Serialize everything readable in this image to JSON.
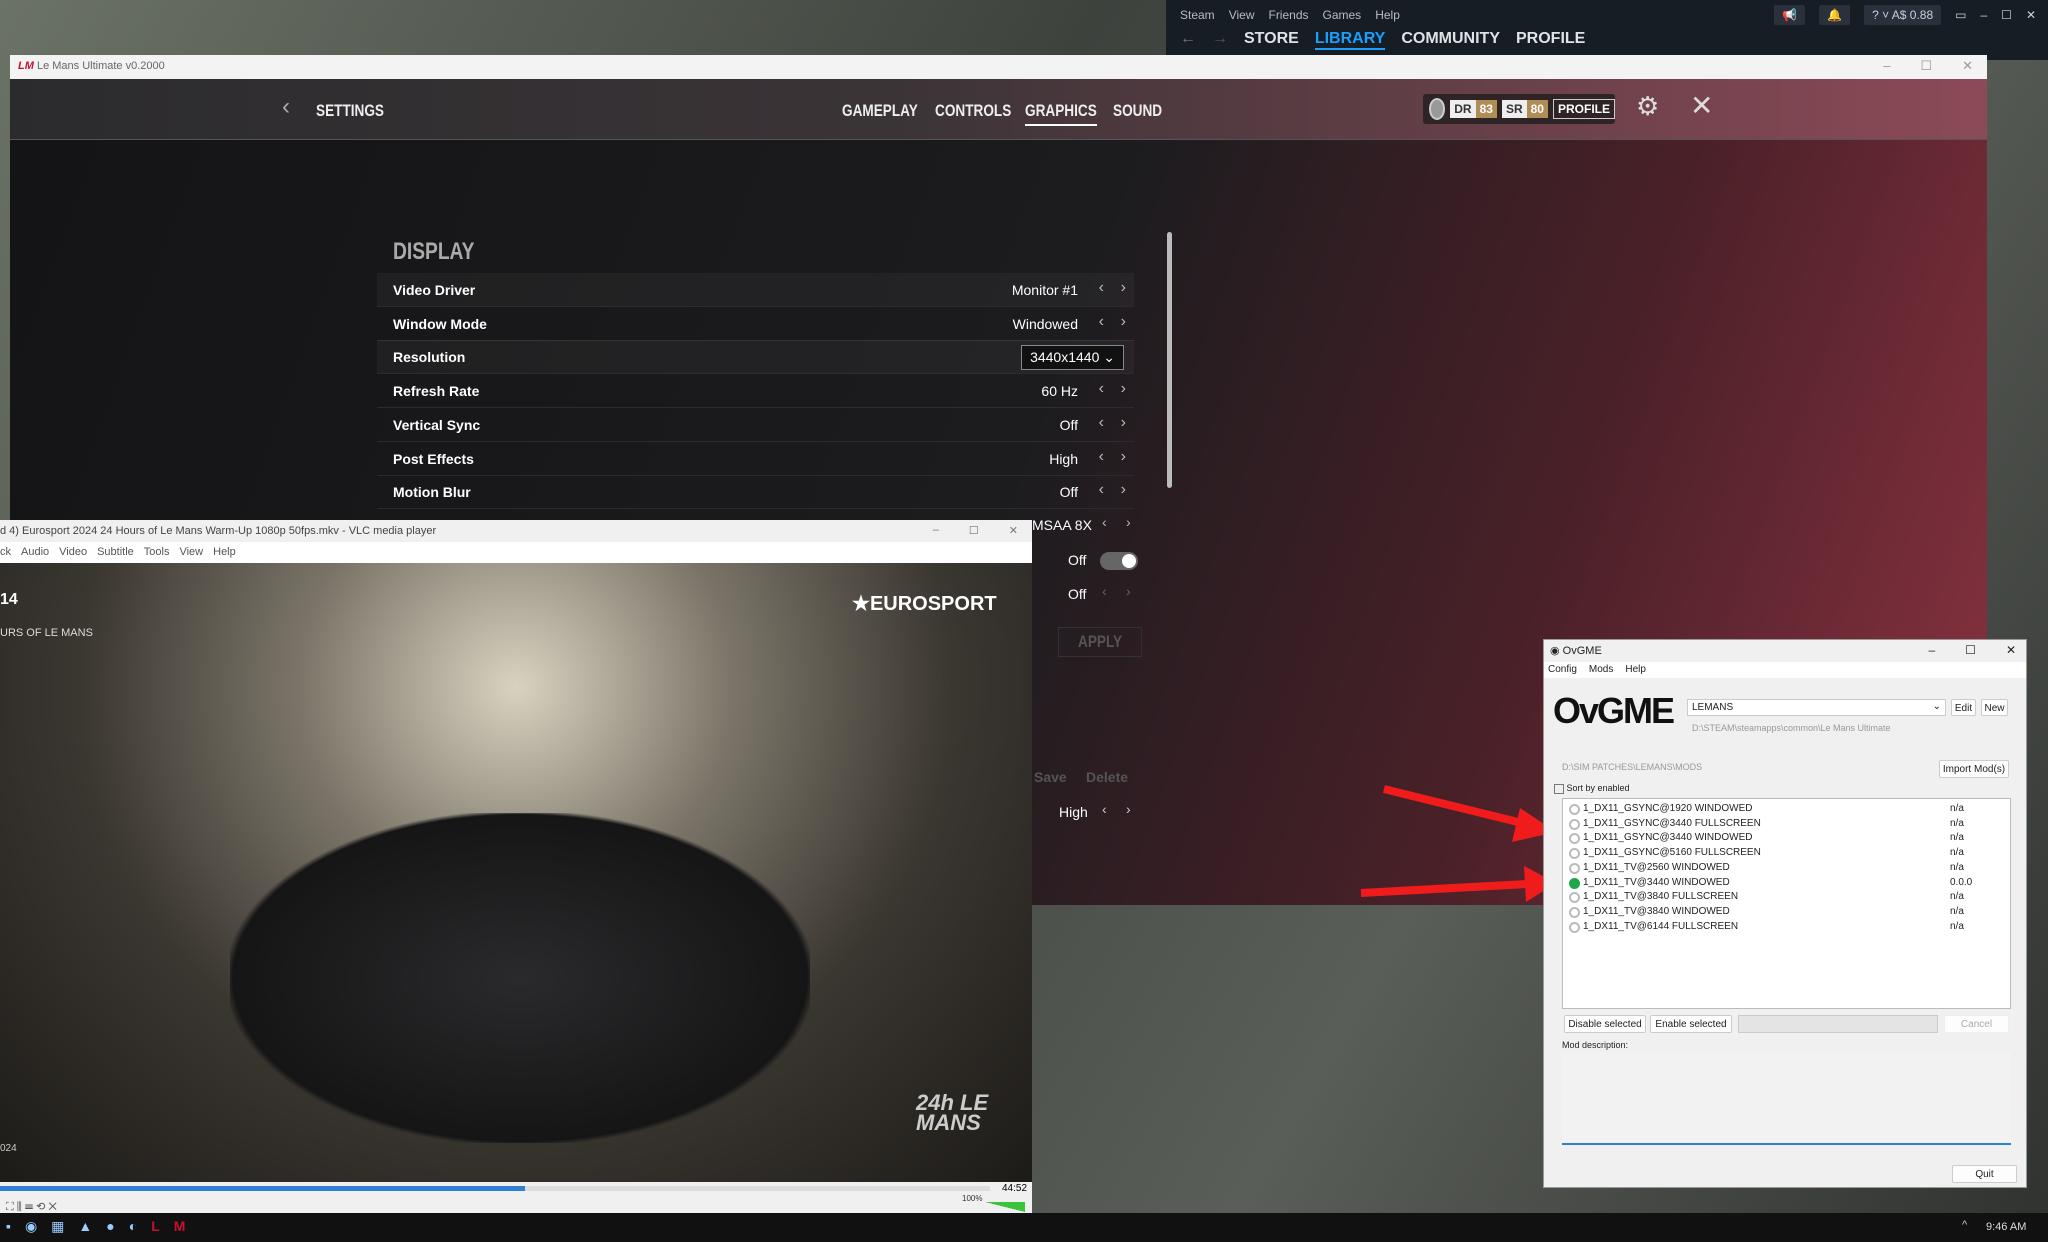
{
  "steam": {
    "menu": [
      "Steam",
      "View",
      "Friends",
      "Games",
      "Help"
    ],
    "nav": [
      "STORE",
      "LIBRARY",
      "COMMUNITY",
      "PROFILE"
    ],
    "active_nav": "LIBRARY",
    "balance": "A$ 0.88",
    "help": "?"
  },
  "lmu": {
    "window_title": "Le Mans Ultimate v0.2000",
    "back_label": "SETTINGS",
    "tabs": [
      "GAMEPLAY",
      "CONTROLS",
      "GRAPHICS",
      "SOUND"
    ],
    "active_tab": "GRAPHICS",
    "dr_label": "DR",
    "dr_value": "83",
    "sr_label": "SR",
    "sr_value": "80",
    "profile_label": "PROFILE",
    "section": "DISPLAY",
    "rows": [
      {
        "label": "Video Driver",
        "value": "Monitor #1"
      },
      {
        "label": "Window Mode",
        "value": "Windowed"
      },
      {
        "label": "Resolution",
        "value": "3440x1440"
      },
      {
        "label": "Refresh Rate",
        "value": "60 Hz"
      },
      {
        "label": "Vertical Sync",
        "value": "Off"
      },
      {
        "label": "Post Effects",
        "value": "High"
      },
      {
        "label": "Motion Blur",
        "value": "Off"
      }
    ],
    "hidden_rows": [
      {
        "value": "MSAA 8X"
      },
      {
        "value": "Off"
      },
      {
        "value": "Off"
      }
    ],
    "apply_label": "APPLY",
    "save_label": "Save",
    "delete_label": "Delete",
    "last_value": "High",
    "accent": "#c8102e"
  },
  "vlc": {
    "title": "d 4) Eurosport 2024 24 Hours of Le Mans Warm-Up 1080p 50fps.mkv - VLC media player",
    "menu": [
      "ck",
      "Audio",
      "Video",
      "Subtitle",
      "Tools",
      "View",
      "Help"
    ],
    "overlay_brand": "EUROSPORT",
    "overlay_left": "14",
    "overlay_left2": "URS OF LE MANS",
    "watermark": "24h LE MANS",
    "year": "024",
    "time_total": "44:52",
    "progress_percent": 53,
    "volume": "100%"
  },
  "ovgme": {
    "title": "OvGME",
    "menu": [
      "Config",
      "Mods",
      "Help"
    ],
    "profile": "LEMANS",
    "edit_label": "Edit",
    "new_label": "New",
    "game_path": "D:\\STEAM\\steamapps\\common\\Le Mans Ultimate",
    "mods_path": "D:\\SIM PATCHES\\LEMANS\\MODS",
    "import_label": "Import Mod(s)",
    "sort_label": "Sort by enabled",
    "mods": [
      {
        "name": "1_DX11_GSYNC@1920 WINDOWED",
        "version": "n/a",
        "enabled": false
      },
      {
        "name": "1_DX11_GSYNC@3440 FULLSCREEN",
        "version": "n/a",
        "enabled": false
      },
      {
        "name": "1_DX11_GSYNC@3440 WINDOWED",
        "version": "n/a",
        "enabled": false
      },
      {
        "name": "1_DX11_GSYNC@5160 FULLSCREEN",
        "version": "n/a",
        "enabled": false
      },
      {
        "name": "1_DX11_TV@2560 WINDOWED",
        "version": "n/a",
        "enabled": false
      },
      {
        "name": "1_DX11_TV@3440 WINDOWED",
        "version": "0.0.0",
        "enabled": true
      },
      {
        "name": "1_DX11_TV@3840 FULLSCREEN",
        "version": "n/a",
        "enabled": false
      },
      {
        "name": "1_DX11_TV@3840 WINDOWED",
        "version": "n/a",
        "enabled": false
      },
      {
        "name": "1_DX11_TV@6144 FULLSCREEN",
        "version": "n/a",
        "enabled": false
      }
    ],
    "disable_label": "Disable selected",
    "enable_label": "Enable selected",
    "cancel_label": "Cancel",
    "desc_label": "Mod description:",
    "quit_label": "Quit"
  },
  "taskbar": {
    "clock": "9:46 AM"
  }
}
